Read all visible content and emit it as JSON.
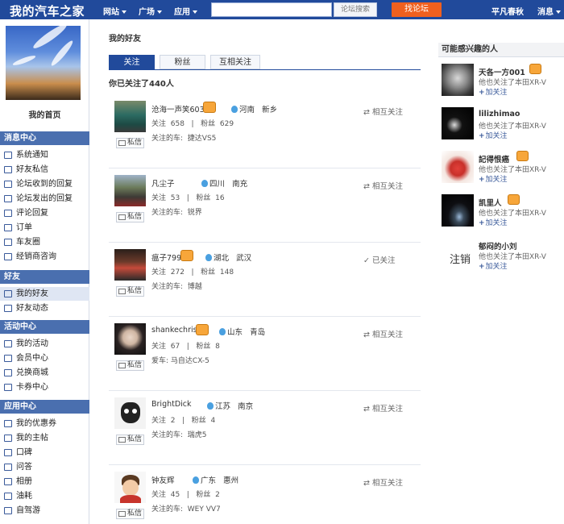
{
  "topbar": {
    "logo": "我的汽车之家",
    "nav": [
      "网站",
      "广场",
      "应用"
    ],
    "search_placeholder": "",
    "search_button": "论坛搜索",
    "forum_button": "找论坛",
    "username": "平凡春秋",
    "messages": "消息"
  },
  "sidebar": {
    "home": "我的首页",
    "sections": [
      {
        "title": "消息中心",
        "items": [
          "系统通知",
          "好友私信",
          "论坛收到的回复",
          "论坛发出的回复",
          "评论回复",
          "订单",
          "车友圈",
          "经销商咨询"
        ]
      },
      {
        "title": "好友",
        "items": [
          "我的好友",
          "好友动态"
        ]
      },
      {
        "title": "活动中心",
        "items": [
          "我的活动",
          "会员中心",
          "兑换商城",
          "卡券中心"
        ]
      },
      {
        "title": "应用中心",
        "items": [
          "我的优惠券",
          "我的主帖",
          "口碑",
          "问答",
          "相册",
          "油耗",
          "自驾游"
        ]
      }
    ]
  },
  "main": {
    "title": "我的好友",
    "tabs": [
      "关注",
      "粉丝",
      "互相关注"
    ],
    "count_text": "你已关注了440人",
    "pm_label": "私信",
    "friends": [
      {
        "name": "沧海一声笑603",
        "vip": true,
        "province": "河南",
        "city": "新乡",
        "following_label": "关注",
        "following": "658",
        "fans_label": "粉丝",
        "fans": "629",
        "car_label": "关注的车:",
        "car": "捷达VS5",
        "status": "相互关注"
      },
      {
        "name": "凡尘子",
        "vip": false,
        "province": "四川",
        "city": "南充",
        "following_label": "关注",
        "following": "53",
        "fans_label": "粉丝",
        "fans": "16",
        "car_label": "关注的车:",
        "car": "锐界",
        "status": "相互关注"
      },
      {
        "name": "瘟子799",
        "vip": true,
        "province": "湖北",
        "city": "武汉",
        "following_label": "关注",
        "following": "272",
        "fans_label": "粉丝",
        "fans": "148",
        "car_label": "关注的车:",
        "car": "博越",
        "status": "已关注"
      },
      {
        "name": "shankechris",
        "vip": true,
        "province": "山东",
        "city": "青岛",
        "following_label": "关注",
        "following": "67",
        "fans_label": "粉丝",
        "fans": "8",
        "car_label": "爱车:",
        "car": "马自达CX-5",
        "status": "相互关注"
      },
      {
        "name": "BrightDick",
        "vip": false,
        "province": "江苏",
        "city": "南京",
        "following_label": "关注",
        "following": "2",
        "fans_label": "粉丝",
        "fans": "4",
        "car_label": "关注的车:",
        "car": "瑞虎5",
        "status": "相互关注"
      },
      {
        "name": "钟友辉",
        "vip": false,
        "province": "广东",
        "city": "惠州",
        "following_label": "关注",
        "following": "45",
        "fans_label": "粉丝",
        "fans": "2",
        "car_label": "关注的车:",
        "car": "WEY VV7",
        "status": "相互关注"
      }
    ]
  },
  "right": {
    "title": "可能感兴趣的人",
    "add_label": "加关注",
    "suggestions": [
      {
        "name": "天各一方001",
        "vip": true,
        "sub": "他也关注了本田XR-V"
      },
      {
        "name": "lilizhimao",
        "vip": false,
        "sub": "他也关注了本田XR-V"
      },
      {
        "name": "記得恨癌",
        "vip": true,
        "sub": "他也关注了本田XR-V"
      },
      {
        "name": "凯里人",
        "vip": true,
        "sub": "他也关注了本田XR-V"
      },
      {
        "name": "郁闷的小刘",
        "vip": false,
        "sub": "他也关注了本田XR-V",
        "avatar_text": "注销"
      }
    ]
  }
}
